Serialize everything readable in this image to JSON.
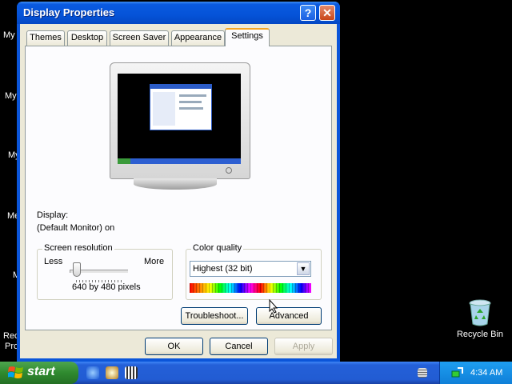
{
  "desktop": {
    "icon_labels": [
      "My",
      "My",
      "My",
      "Me",
      "M",
      "Rec",
      "Pro"
    ],
    "recycle_bin": "Recycle Bin"
  },
  "window": {
    "title": "Display Properties",
    "help_button": "?",
    "close_button": "✕",
    "tabs": [
      "Themes",
      "Desktop",
      "Screen Saver",
      "Appearance",
      "Settings"
    ],
    "active_tab": "Settings",
    "display_label": "Display:",
    "display_value": "(Default Monitor) on",
    "screen_resolution": {
      "legend": "Screen resolution",
      "less": "Less",
      "more": "More",
      "value": "640 by 480 pixels",
      "slider_position": 0
    },
    "color_quality": {
      "legend": "Color quality",
      "selected": "Highest (32 bit)"
    },
    "buttons": {
      "troubleshoot": "Troubleshoot...",
      "advanced": "Advanced",
      "ok": "OK",
      "cancel": "Cancel",
      "apply": "Apply"
    }
  },
  "taskbar": {
    "start_label": "start",
    "clock": "4:34 AM"
  },
  "colors": {
    "titlebar": "#0553d8",
    "dialog_bg": "#ece9d8",
    "taskbar": "#225cd3",
    "start_button": "#2f8a2f"
  }
}
